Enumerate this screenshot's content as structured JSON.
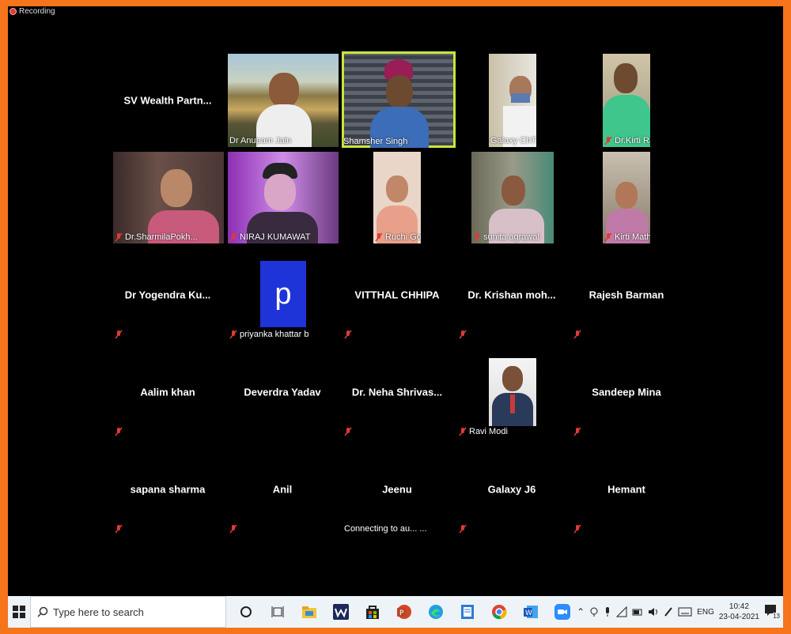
{
  "recording": {
    "label": "Recording"
  },
  "participants": [
    {
      "name": "SV Wealth Partn...",
      "kind": "name",
      "muted": false
    },
    {
      "name": "Dr Anupam Jain",
      "kind": "video"
    },
    {
      "name": "Shamsher Singh",
      "kind": "video",
      "active_speaker": true
    },
    {
      "name": "Galaxy ChT Pro",
      "kind": "video"
    },
    {
      "name": "Dr.Kirti Rawat",
      "kind": "video",
      "muted": true
    },
    {
      "name": "Dr.SharmilaPokh...",
      "kind": "video",
      "muted": true
    },
    {
      "name": "NIRAJ KUMAWAT",
      "kind": "video",
      "muted": true
    },
    {
      "name": "Ruchi Goyal",
      "kind": "video",
      "muted": true
    },
    {
      "name": "sunita agrawal",
      "kind": "video",
      "muted": true
    },
    {
      "name": "Kirti Mathur",
      "kind": "video",
      "muted": true
    },
    {
      "name": "Dr Yogendra Ku...",
      "kind": "name",
      "muted": true
    },
    {
      "name": "priyanka khattar b",
      "kind": "avatar",
      "avatar_letter": "p",
      "muted": true
    },
    {
      "name": "VITTHAL CHHIPA",
      "kind": "name",
      "muted": true
    },
    {
      "name": "Dr. Krishan moh...",
      "kind": "name",
      "muted": true
    },
    {
      "name": "Rajesh Barman",
      "kind": "name",
      "muted": true
    },
    {
      "name": "Aalim khan",
      "kind": "name",
      "muted": true
    },
    {
      "name": "Deverdra Yadav",
      "kind": "name",
      "muted": false
    },
    {
      "name": "Dr. Neha Shrivas...",
      "kind": "name",
      "muted": true
    },
    {
      "name": "Ravi Modi",
      "kind": "video",
      "muted": true
    },
    {
      "name": "Sandeep Mina",
      "kind": "name",
      "muted": true
    },
    {
      "name": "sapana sharma",
      "kind": "name",
      "muted": true
    },
    {
      "name": "Anil",
      "kind": "name",
      "muted": true
    },
    {
      "name": "Jeenu",
      "kind": "name",
      "muted": false,
      "status": "Connecting to au... ..."
    },
    {
      "name": "Galaxy J6",
      "kind": "name",
      "muted": true
    },
    {
      "name": "Hemant",
      "kind": "name",
      "muted": true
    }
  ],
  "taskbar": {
    "search_placeholder": "Type here to search",
    "apps": [
      "cortana-icon",
      "task-view-icon",
      "file-explorer-icon",
      "winamp-icon",
      "store-icon",
      "powerpoint-icon",
      "edge-icon",
      "notepad-icon",
      "chrome-icon",
      "word-icon",
      "zoom-icon"
    ],
    "language": "ENG",
    "time": "10:42",
    "date": "23-04-2021",
    "notification_count": "13"
  },
  "colors": {
    "frame": "#f6741c",
    "active_speaker": "#c8e63c",
    "mute": "#e03a32",
    "avatar": "#1e33d8"
  }
}
